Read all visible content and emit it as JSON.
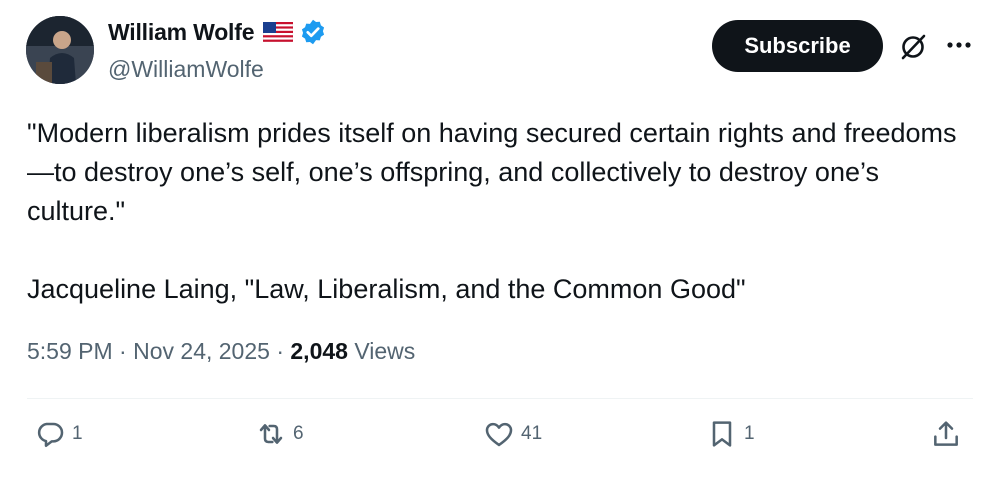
{
  "author": {
    "display_name": "William Wolfe",
    "handle": "@WilliamWolfe",
    "flag_emoji": "us-flag-icon",
    "verified": true,
    "verified_color": "#1d9bf0"
  },
  "header": {
    "subscribe_label": "Subscribe",
    "grok_icon": "grok-icon",
    "more_icon": "more-options-icon"
  },
  "tweet": {
    "quote": "\"Modern liberalism prides itself on having secured certain rights and freedoms—to destroy one’s self, one’s offspring, and collectively to destroy one’s culture.\"",
    "attribution": "Jacqueline Laing, \"Law, Liberalism, and the Common Good\""
  },
  "meta": {
    "time": "5:59 PM",
    "separator": "·",
    "date": "Nov 24, 2025",
    "views_count": "2,048",
    "views_label": "Views"
  },
  "actions": {
    "replies": "1",
    "reposts": "6",
    "likes": "41",
    "bookmarks": "1"
  },
  "colors": {
    "text": "#0f1419",
    "secondary": "#536471",
    "button_bg": "#0f1419",
    "divider": "#eff3f4"
  }
}
